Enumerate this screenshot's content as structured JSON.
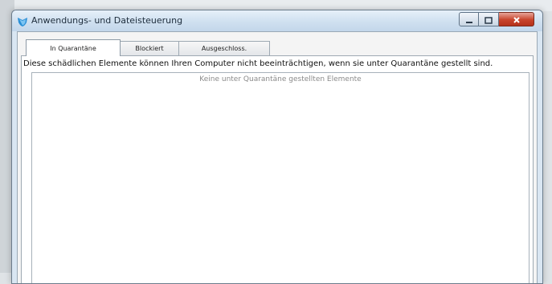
{
  "window": {
    "title": "Anwendungs- und Dateisteuerung",
    "app_icon": "shield-icon",
    "controls": [
      "minimize-icon",
      "maximize-icon",
      "close-icon"
    ],
    "close_color": "#c8432b"
  },
  "tabs": [
    {
      "label": "In Quarantäne",
      "active": true
    },
    {
      "label": "Blockiert",
      "active": false
    },
    {
      "label": "Ausgeschloss.",
      "active": false
    }
  ],
  "quarantine": {
    "description": "Diese schädlichen Elemente können Ihren Computer nicht beeinträchtigen, wenn sie unter Quarantäne gestellt sind.",
    "empty_message": "Keine unter Quarantäne gestellten Elemente"
  },
  "colors": {
    "accent": "#2a8fd6",
    "titlebar": "#cfe0f0"
  }
}
